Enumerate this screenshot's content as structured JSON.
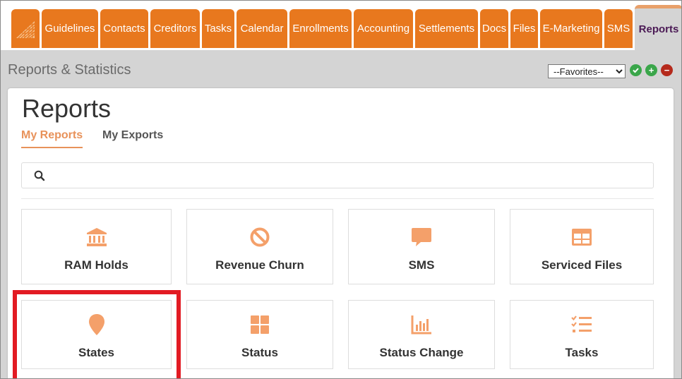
{
  "nav": {
    "tabs": [
      {
        "label": "Guidelines"
      },
      {
        "label": "Contacts"
      },
      {
        "label": "Creditors"
      },
      {
        "label": "Tasks"
      },
      {
        "label": "Calendar"
      },
      {
        "label": "Enrollments"
      },
      {
        "label": "Accounting"
      },
      {
        "label": "Settlements"
      },
      {
        "label": "Docs"
      },
      {
        "label": "Files"
      },
      {
        "label": "E-Marketing"
      },
      {
        "label": "SMS"
      },
      {
        "label": "Reports"
      }
    ],
    "active_tab": "Reports"
  },
  "subbar": {
    "heading": "Reports & Statistics",
    "favorites_selected": "--Favorites--",
    "add_icon": "+",
    "remove_icon": "−"
  },
  "panel": {
    "title": "Reports",
    "tabs": {
      "my_reports": "My Reports",
      "my_exports": "My Exports"
    },
    "search": {
      "value": "",
      "placeholder": ""
    },
    "cards": [
      {
        "label": "RAM Holds",
        "icon": "bank-icon"
      },
      {
        "label": "Revenue Churn",
        "icon": "ban-icon"
      },
      {
        "label": "SMS",
        "icon": "comment-icon"
      },
      {
        "label": "Serviced Files",
        "icon": "table-icon"
      },
      {
        "label": "States",
        "icon": "map-marker-icon"
      },
      {
        "label": "Status",
        "icon": "grid-icon"
      },
      {
        "label": "Status Change",
        "icon": "bar-chart-icon"
      },
      {
        "label": "Tasks",
        "icon": "tasks-icon"
      }
    ]
  },
  "colors": {
    "brand_orange": "#e8781e",
    "icon_orange": "#f4a06a",
    "active_tab_text": "#4b1a55",
    "highlight_red": "#e21b23"
  }
}
